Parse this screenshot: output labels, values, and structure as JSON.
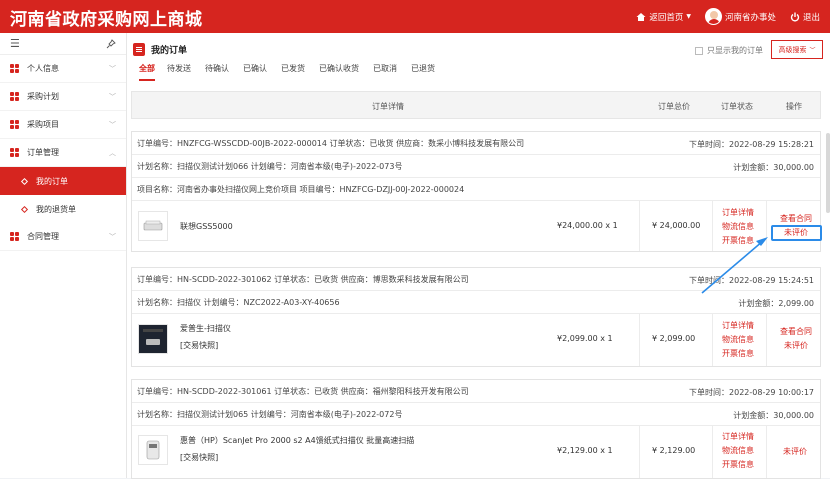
{
  "header": {
    "site_title": "河南省政府采购网上商城",
    "home_link": "返回首页",
    "user_name": "河南省办事处",
    "logout": "退出"
  },
  "sidebar": {
    "items": [
      {
        "label": "个人信息"
      },
      {
        "label": "采购计划"
      },
      {
        "label": "采购项目"
      },
      {
        "label": "订单管理"
      },
      {
        "label": "合同管理"
      }
    ],
    "sub_items": [
      {
        "label": "我的订单"
      },
      {
        "label": "我的退货单"
      }
    ]
  },
  "page": {
    "title": "我的订单",
    "only_mine": "只显示我的订单",
    "advanced_search": "高级搜索"
  },
  "tabs": [
    "全部",
    "待发送",
    "待确认",
    "已确认",
    "已发货",
    "已确认收货",
    "已取消",
    "已退货"
  ],
  "table_headers": {
    "details": "订单详情",
    "total": "订单总价",
    "status": "订单状态",
    "action": "操作"
  },
  "orders": [
    {
      "line1": "订单编号：HNZFCG-WSSCDD-00JB-2022-000014    订单状态：已收货    供应商：数采小博科技发展有限公司",
      "time": "下单时间：2022-08-29 15:28:21",
      "line2": "计划名称：扫描仪测试计划066    计划编号：河南省本级(电子)-2022-073号",
      "amount": "计划金额：30,000.00",
      "line3": "项目名称：河南省办事处扫描仪网上竞价项目    项目编号：HNZFCG-DZJJ-00J-2022-000024",
      "product": "联想GSS5000",
      "product_sub": "",
      "unit_price": "¥24,000.00 x 1",
      "total": "¥ 24,000.00",
      "links": [
        "订单详情",
        "物流信息",
        "开票信息"
      ],
      "ops": [
        "查看合同",
        "未评价"
      ]
    },
    {
      "line1": "订单编号：HN-SCDD-2022-301062    订单状态：已收货    供应商：博思数采科技发展有限公司",
      "time": "下单时间：2022-08-29 15:24:51",
      "line2": "计划名称：扫描仪    计划编号：NZC2022-A03-XY-40656",
      "amount": "计划金额：2,099.00",
      "product": "爱普生-扫描仪",
      "product_sub": "[交易快照]",
      "unit_price": "¥2,099.00 x 1",
      "total": "¥ 2,099.00",
      "links": [
        "订单详情",
        "物流信息",
        "开票信息"
      ],
      "ops": [
        "查看合同",
        "未评价"
      ]
    },
    {
      "line1": "订单编号：HN-SCDD-2022-301061    订单状态：已收货    供应商：福州黎阳科技开发有限公司",
      "time": "下单时间：2022-08-29 10:00:17",
      "line2": "计划名称：扫描仪测试计划065    计划编号：河南省本级(电子)-2022-072号",
      "amount": "计划金额：30,000.00",
      "product": "惠普（HP）ScanJet Pro 2000 s2 A4馈纸式扫描仪 批量高速扫描",
      "product_sub": "[交易快照]",
      "unit_price": "¥2,129.00 x 1",
      "total": "¥ 2,129.00",
      "links": [
        "订单详情",
        "物流信息",
        "开票信息"
      ],
      "ops": [
        "未评价"
      ]
    }
  ],
  "colors": {
    "brand": "#d6251f",
    "highlight": "#2b8be8"
  }
}
